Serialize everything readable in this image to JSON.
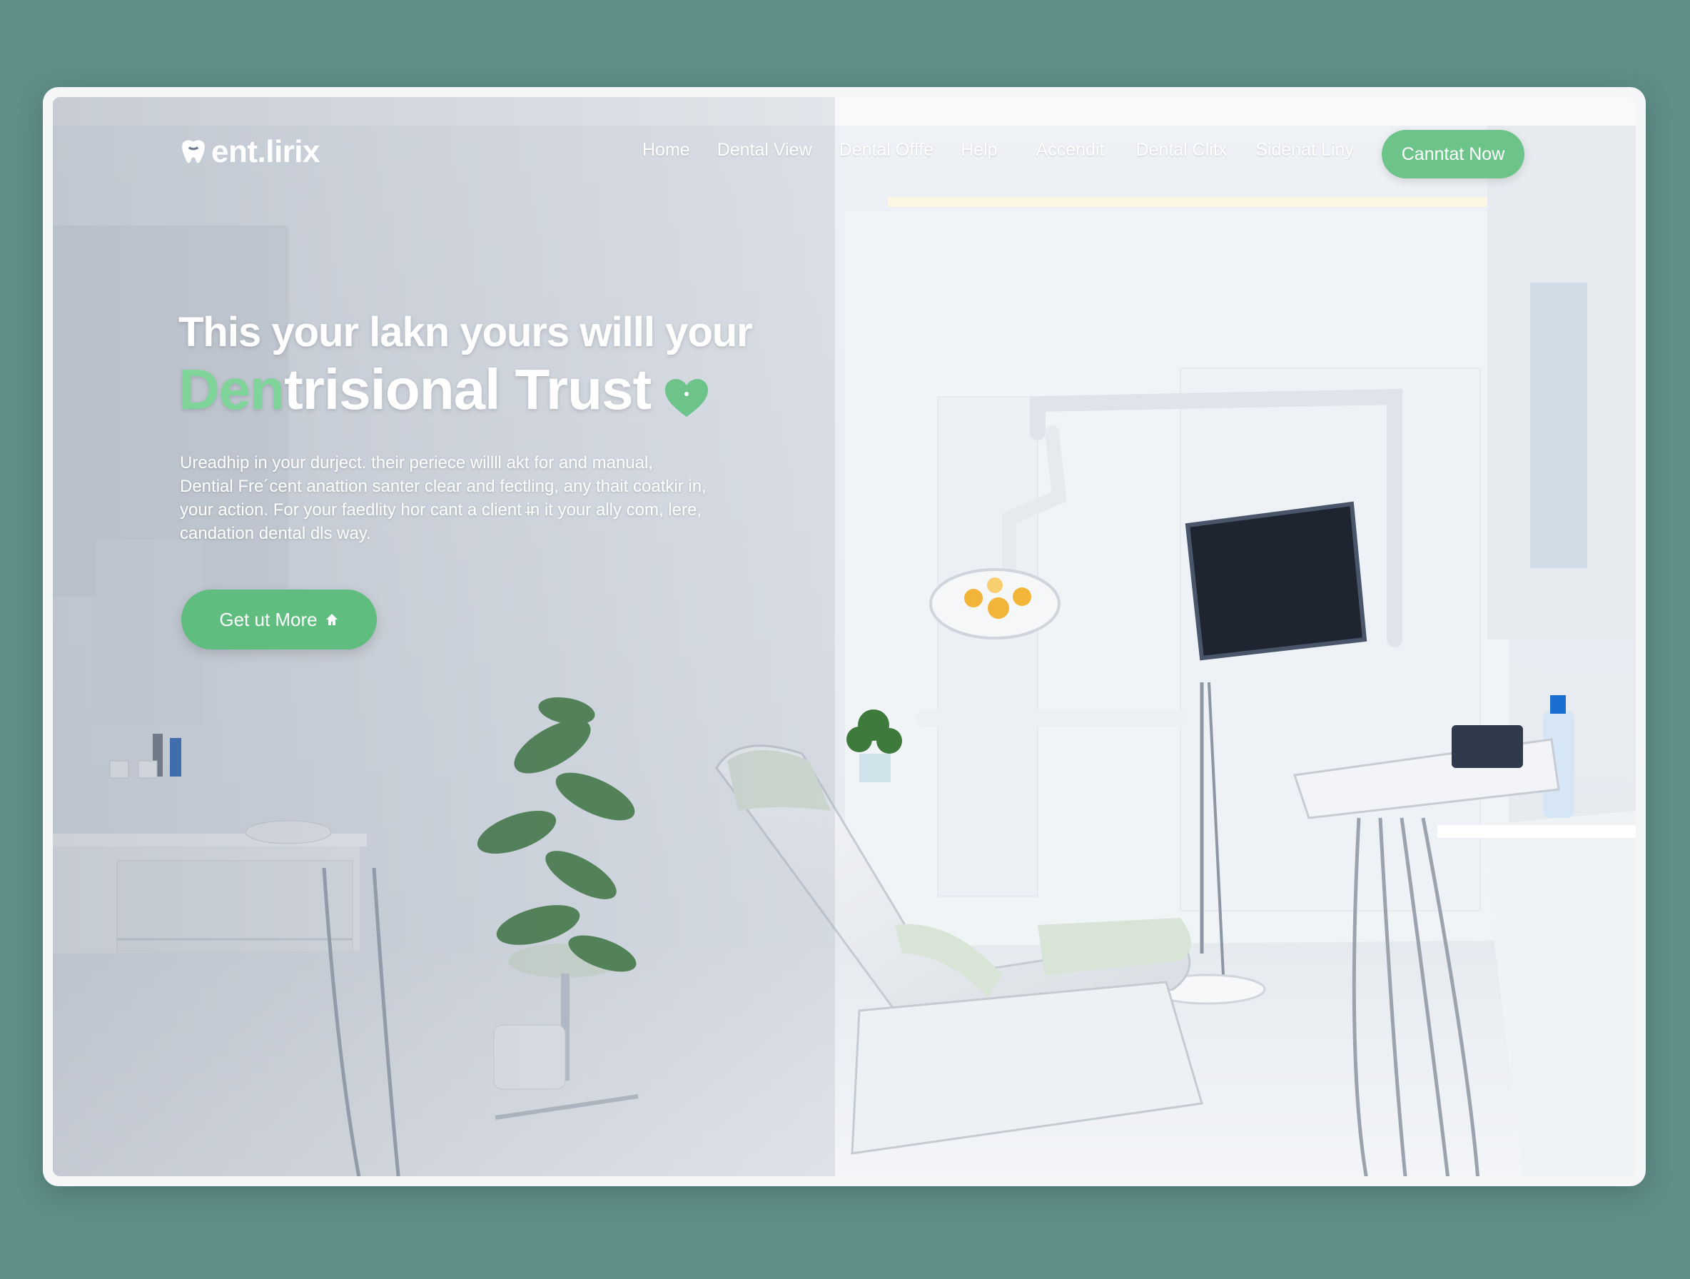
{
  "brand": {
    "name": "ent.lirix",
    "logo_icon": "tooth-icon"
  },
  "nav": {
    "items": [
      {
        "label": "Home"
      },
      {
        "label": "Dental View"
      },
      {
        "label": "Dental Offfe"
      },
      {
        "label": "Help"
      },
      {
        "label": "Accendit"
      },
      {
        "label": "Dental Clitx"
      },
      {
        "label": "Sidenat Liny"
      }
    ],
    "contact_label": "Canntat Now"
  },
  "hero": {
    "title_line1": "This your lakn yours willl your",
    "title_line2_accent": "Den",
    "title_line2_rest": "trisional Trust",
    "heart_icon": "heart-icon",
    "body_lines": [
      "Ureadhip in your durject. their periece willll akt for and manual,",
      "Dential Fre´cent anattion santer clear and fectling, any thait coatkir in,",
      "your action. For your faedlity hor cant a client i̶n it your ally com, lere,",
      "candation dental dls way."
    ],
    "cta_label": "Get ut More",
    "cta_icon": "home-icon"
  },
  "colors": {
    "background": "#5f8f88",
    "accent_green": "#6dc48a",
    "text_on_image": "#ffffff"
  }
}
